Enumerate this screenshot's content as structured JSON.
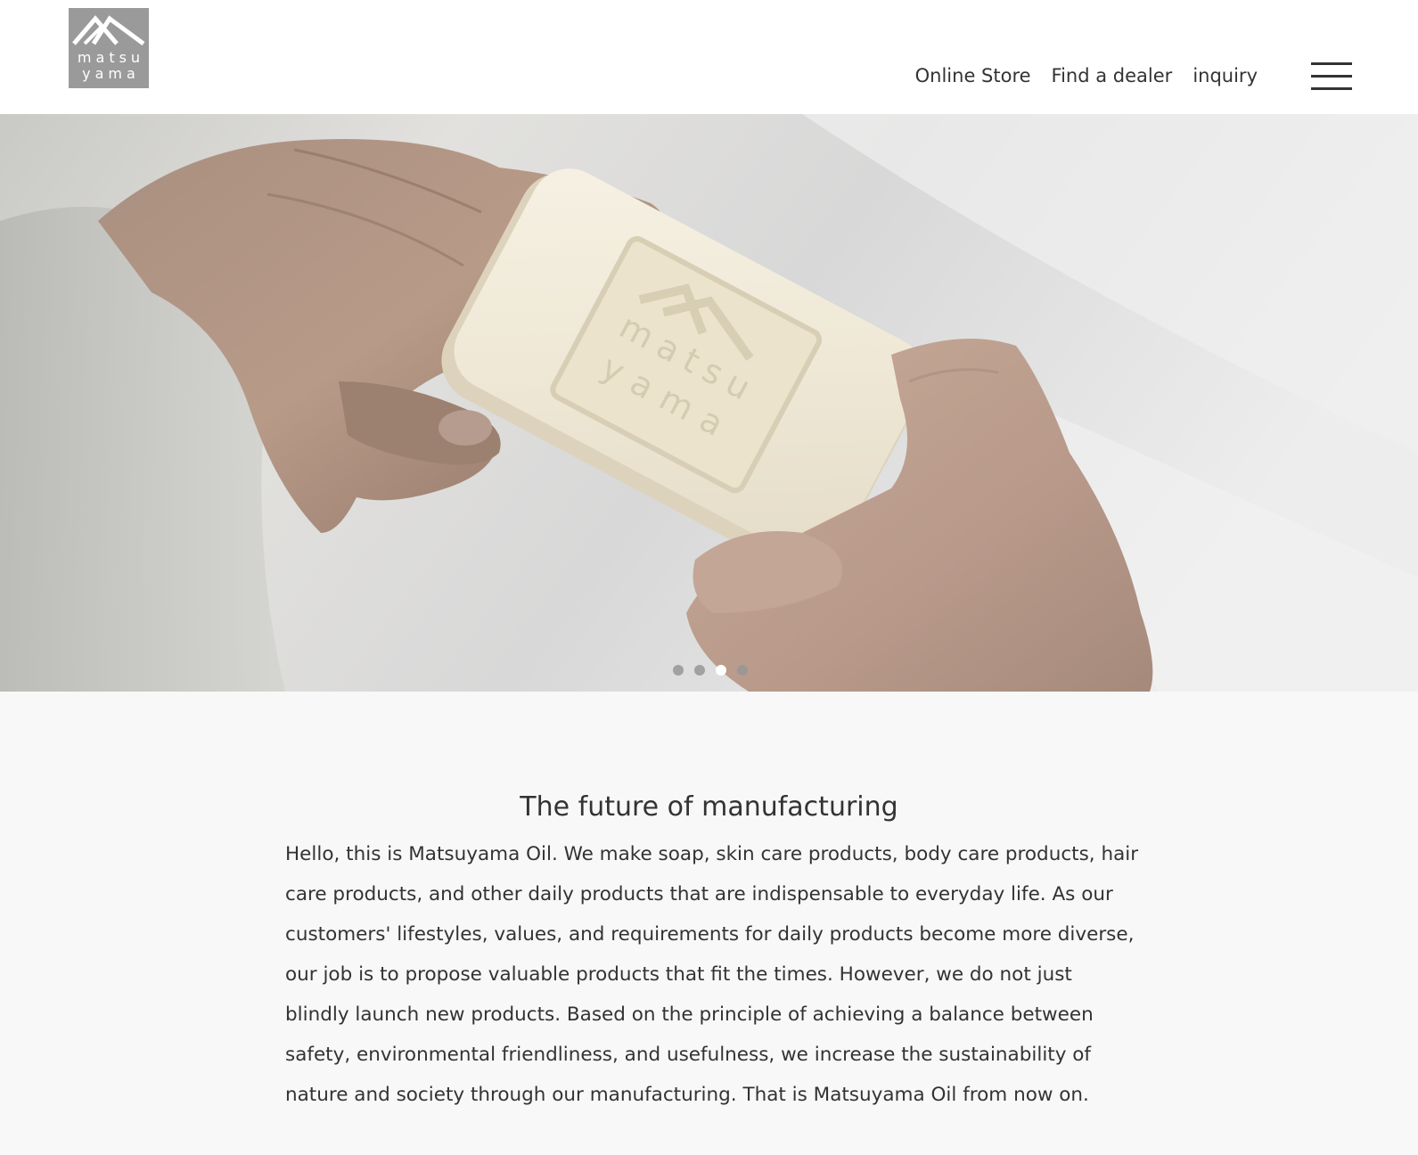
{
  "brand": {
    "logo_line1": "matsu",
    "logo_line2": "yama",
    "logo_bg_color": "#9a9a9a"
  },
  "nav": {
    "items": [
      {
        "label": "Online Store"
      },
      {
        "label": "Find a dealer"
      },
      {
        "label": "inquiry"
      }
    ]
  },
  "hero": {
    "soap_stamp_line1": "matsu",
    "soap_stamp_line2": "yama",
    "slides_total": 4,
    "active_slide": 3
  },
  "intro": {
    "title": "The future of manufacturing",
    "body": "Hello, this is Matsuyama Oil. We make soap, skin care products, body care products, hair care products, and other daily products that are indispensable to everyday life. As our customers' lifestyles, values, and requirements for daily products become more diverse, our job is to propose valuable products that fit the times. However, we do not just blindly launch new products. Based on the principle of achieving a balance between safety, environmental friendliness, and usefulness, we increase the sustainability of nature and society through our manufacturing. That is Matsuyama Oil from now on."
  },
  "icons": [
    "mountain-logo-icon",
    "hamburger-menu-icon"
  ],
  "colors": {
    "text": "#333333",
    "header_bg": "#ffffff",
    "content_bg": "#f8f8f8",
    "dot_active": "#ffffff",
    "dot_inactive": "#969696"
  }
}
